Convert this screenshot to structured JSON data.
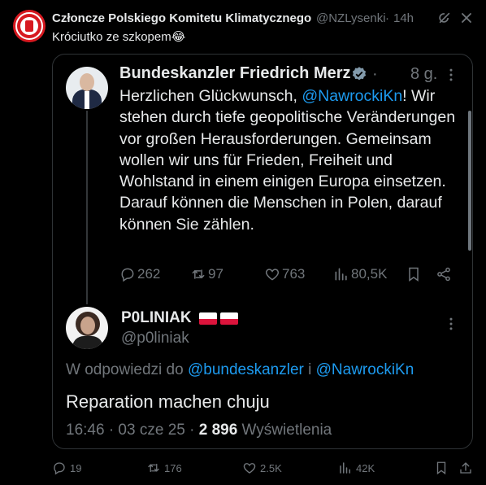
{
  "outer_tweet": {
    "author_name": "Członcze Polskiego Komitetu Klimatycznego",
    "handle": "@NZLysenki",
    "separator": "·",
    "time": "14h",
    "text": "Króciutko ze szkopem😂",
    "actions": {
      "replies": "19",
      "retweets": "176",
      "likes": "2.5K",
      "views": "42K"
    }
  },
  "quoted_tweet": {
    "author_name": "Bundeskanzler Friedrich Merz",
    "time_prefix": "·",
    "time": "8 g.",
    "text_before": "Herzlichen Glückwunsch, ",
    "mention": "@NawrockiKn",
    "text_after": "! Wir stehen durch tiefe geopolitische Veränderungen vor großen Herausforderungen. Gemeinsam wollen wir uns für Frieden, Freiheit und Wohlstand in einem einigen Europa einsetzen. Darauf können die Menschen in Polen, darauf können Sie zählen.",
    "actions": {
      "replies": "262",
      "retweets": "97",
      "likes": "763",
      "views": "80,5K"
    }
  },
  "reply": {
    "author_name": "P0LINIAK",
    "handle": "@p0liniak",
    "reply_prefix": "W odpowiedzi do ",
    "reply_mention_1": "@bundeskanzler",
    "reply_conj": " i ",
    "reply_mention_2": "@NawrockiKn",
    "text": "Reparation machen chuju",
    "time": "16:46 · 03 cze 25 · ",
    "views_count": "2 896",
    "views_label": " Wyświetlenia"
  },
  "colors": {
    "background": "#000000",
    "text": "#e7e9ea",
    "secondary": "#71767b",
    "link": "#1d9bf0",
    "verified": "#829aab",
    "border": "#2f3336"
  }
}
